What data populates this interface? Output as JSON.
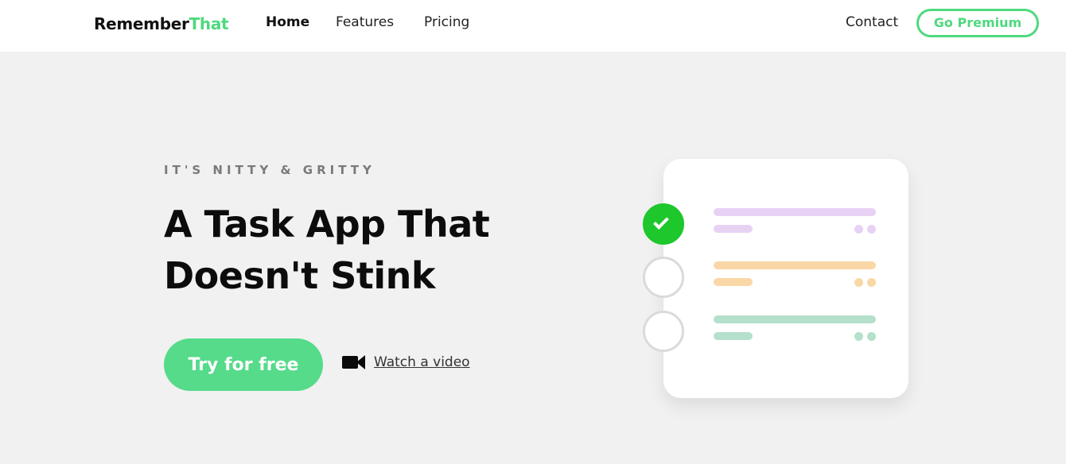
{
  "brand": {
    "part1": "Remember",
    "part2": "That"
  },
  "nav": {
    "links": [
      {
        "label": "Home",
        "active": true
      },
      {
        "label": "Features",
        "active": false
      },
      {
        "label": "Pricing",
        "active": false
      }
    ],
    "contact": "Contact",
    "premium": "Go Premium"
  },
  "hero": {
    "eyebrow": "IT'S NITTY & GRITTY",
    "headline_line1": "A Task App That",
    "headline_line2": "Doesn't Stink",
    "cta": "Try for free",
    "video_label": "Watch a video",
    "video_icon": "video-camera-icon"
  },
  "task_card": {
    "tasks": [
      {
        "checked": true,
        "color": "#e8d2f4"
      },
      {
        "checked": false,
        "color": "#fad7a6"
      },
      {
        "checked": false,
        "color": "#b5e0cb"
      }
    ]
  },
  "colors": {
    "accent": "#55db8a",
    "check_green": "#1ec72c",
    "background": "#f1f1f1"
  }
}
